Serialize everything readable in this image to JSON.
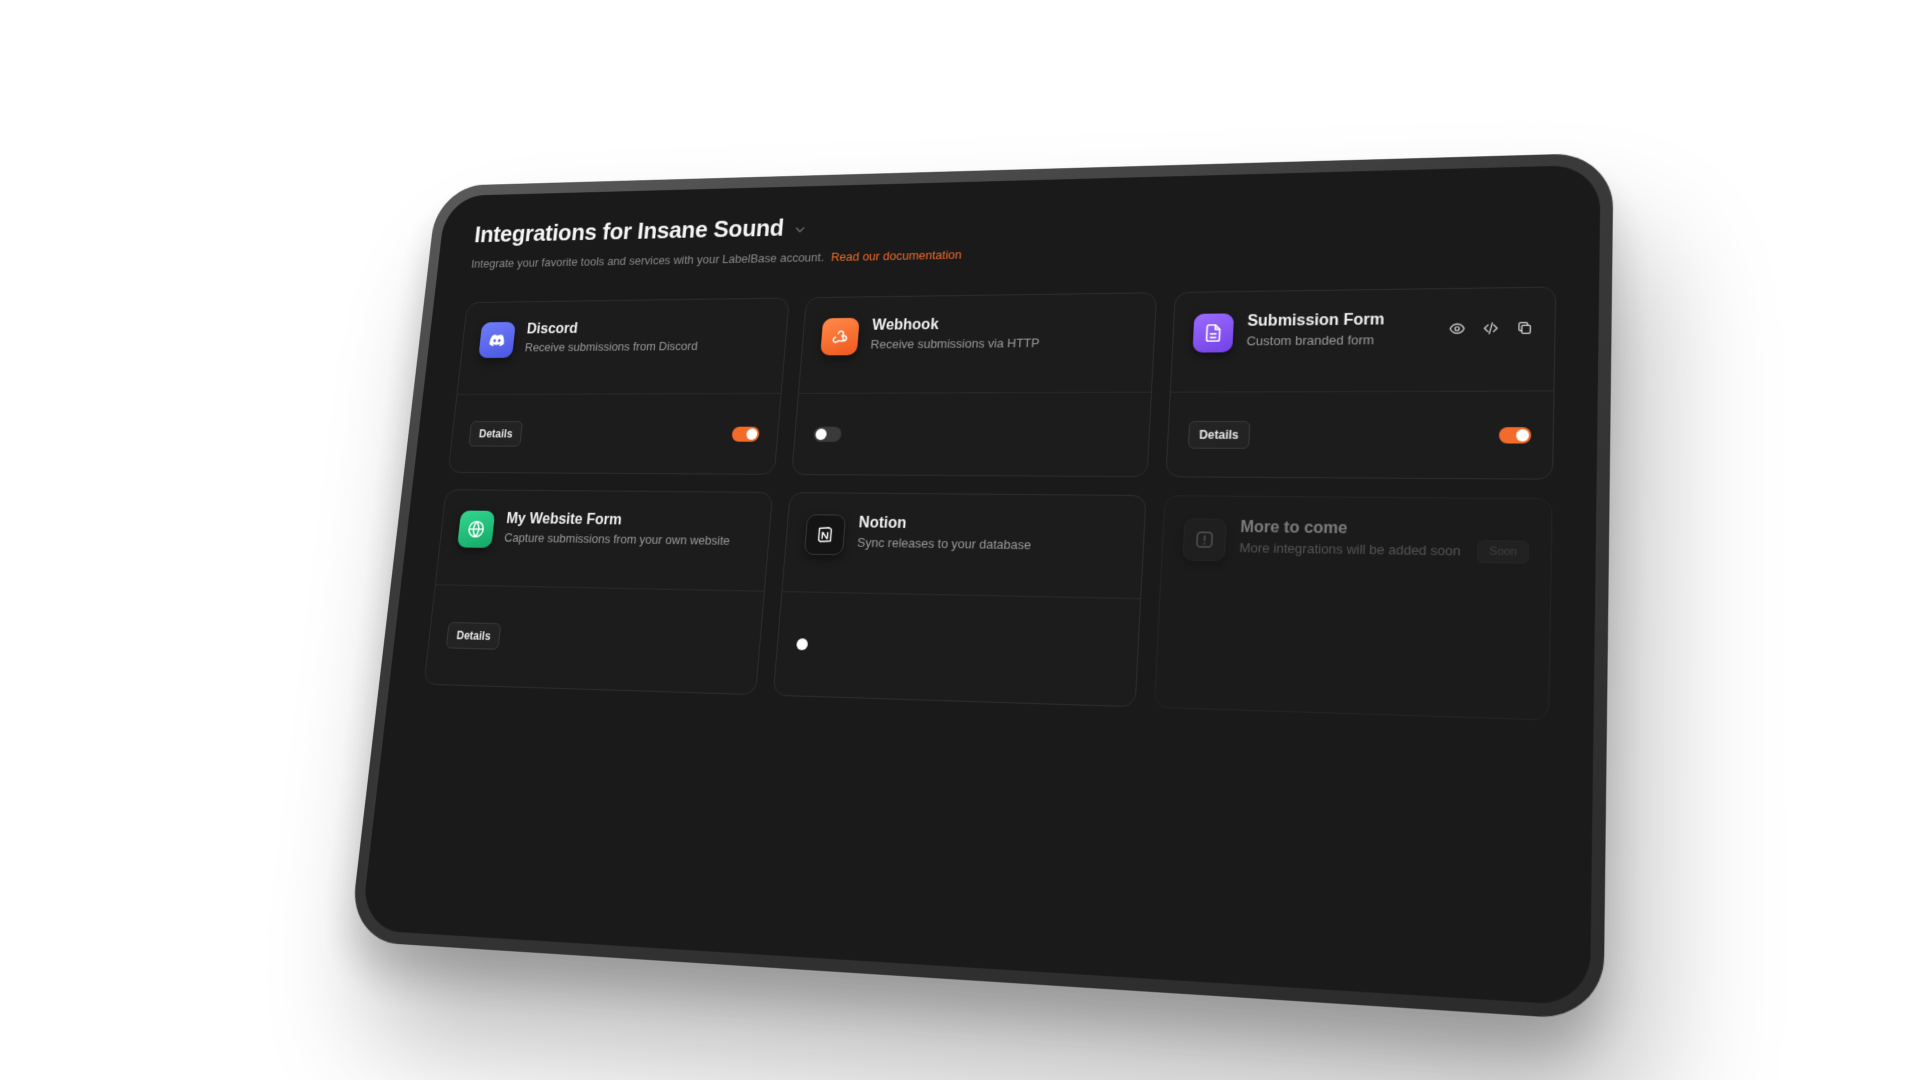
{
  "header": {
    "title": "Integrations for Insane Sound",
    "subtitle": "Integrate your favorite tools and services with your LabelBase account.",
    "doc_link": "Read our documentation"
  },
  "cards": {
    "discord": {
      "name": "Discord",
      "desc": "Receive submissions from Discord",
      "button": "Details",
      "enabled": true,
      "icon": "discord-icon"
    },
    "webhook": {
      "name": "Webhook",
      "desc": "Receive submissions via HTTP",
      "enabled": false,
      "icon": "webhook-icon"
    },
    "submission_form": {
      "name": "Submission Form",
      "desc": "Custom branded form",
      "button": "Details",
      "enabled": true,
      "icon": "file-icon",
      "actions": [
        "eye-icon",
        "code-icon",
        "copy-icon"
      ]
    },
    "website_form": {
      "name": "My Website Form",
      "desc": "Capture submissions from your own website",
      "button": "Details",
      "icon": "globe-icon"
    },
    "notion": {
      "name": "Notion",
      "desc": "Sync releases to your database",
      "icon": "notion-icon"
    },
    "more": {
      "name": "More to come",
      "desc": "More integrations will be added soon",
      "badge": "Soon",
      "icon": "info-icon"
    }
  },
  "colors": {
    "accent": "#f26b2a",
    "background": "#1a1a1a",
    "discord": "#5865f2",
    "webhook": "#f26b2a",
    "form": "#8b5cf6",
    "website": "#22c57a"
  }
}
